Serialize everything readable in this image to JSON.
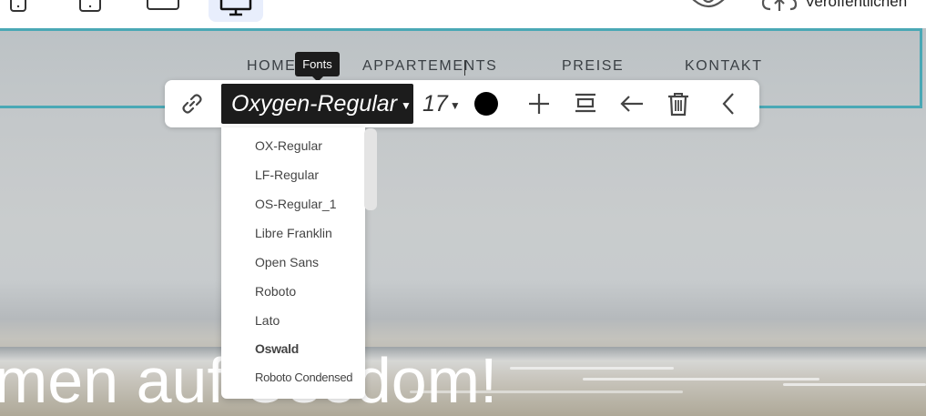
{
  "nav": {
    "links": [
      "HOME",
      "APPARTEMENTS",
      "PREISE",
      "KONTAKT"
    ]
  },
  "header": {
    "publish_label": "Veröffentlichen"
  },
  "hero": {
    "title": "men auf Usedom!"
  },
  "toolbar": {
    "font_value": "Oxygen-Regular",
    "size_value": "17",
    "text_color": "#000000",
    "tooltip": "Fonts",
    "icons": [
      "link-icon",
      "plus-icon",
      "align-center-icon",
      "arrow-left-icon",
      "trash-icon",
      "chevron-left-icon"
    ]
  },
  "dropdown": {
    "options": [
      "OX-Regular",
      "LF-Regular",
      "OS-Regular_1",
      "Libre Franklin",
      "Open Sans",
      "Roboto",
      "Lato",
      "Oswald",
      "Roboto Condensed"
    ]
  },
  "colors": {
    "accent_border": "#4aa8b5",
    "device_active_bg": "#e8eefc",
    "toolbar_dark": "#1c1c1c"
  }
}
